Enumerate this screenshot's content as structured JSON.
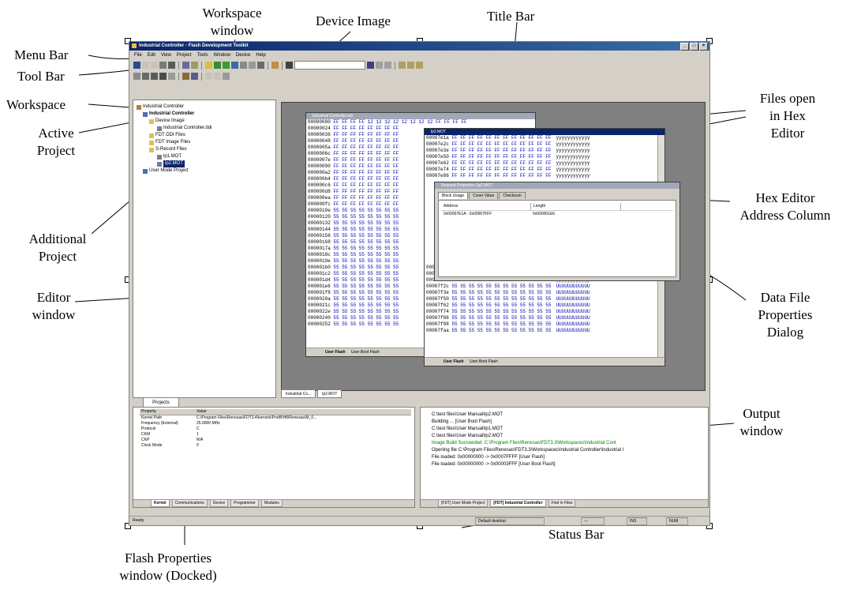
{
  "callouts": {
    "workspace_window": "Workspace window",
    "device_image": "Device Image",
    "title_bar": "Title Bar",
    "menu_bar": "Menu Bar",
    "tool_bar": "Tool Bar",
    "workspace": "Workspace",
    "active_project": "Active Project",
    "files_open_line1": "Files open",
    "files_open_line2": "in Hex",
    "files_open_line3": "Editor",
    "hex_addr_line1": "Hex Editor",
    "hex_addr_line2": "Address Column",
    "additional_project_line1": "Additional",
    "additional_project_line2": "Project",
    "editor_window_line1": "Editor",
    "editor_window_line2": "window",
    "data_file_line1": "Data File",
    "data_file_line2": "Properties",
    "data_file_line3": "Dialog",
    "output_window_line1": "Output",
    "output_window_line2": "window",
    "status_bar": "Status Bar",
    "flash_props_line1": "Flash Properties",
    "flash_props_line2": "window (Docked)"
  },
  "app": {
    "title": "Industrial Controller - Flash Development Toolkit",
    "menu": [
      "File",
      "Edit",
      "View",
      "Project",
      "Tools",
      "Window",
      "Device",
      "Help"
    ],
    "tree": {
      "workspace": "Industrial Controller",
      "active_project": "Industrial Controller",
      "device_image": "Device Image",
      "device_image_file": "Industrial Controller.ddi",
      "fdt_ddi": "FDT DDI Files",
      "fdt_image": "FDT Image Files",
      "srecord": "S-Record Files",
      "file1": "lp1.MOT",
      "file2": "lp2.MOT",
      "additional_project": "User Mode Project"
    },
    "workspace_tab": "Projects",
    "hex1_title": "Industrial Controller.ddi",
    "hex1_rows": [
      [
        "00000000",
        "FF FF FF FF 12 12 12 12 12 12 12 12 FF FF FF FF"
      ],
      [
        "00000024",
        "FF FF FF FF FF FF FF FF"
      ],
      [
        "00000036",
        "FF FF FF FF FF FF FF FF"
      ],
      [
        "00000048",
        "FF FF FF FF FF FF FF FF"
      ],
      [
        "0000005a",
        "FF FF FF FF FF FF FF FF"
      ],
      [
        "0000006c",
        "FF FF FF FF FF FF FF FF"
      ],
      [
        "0000007e",
        "FF FF FF FF FF FF FF FF"
      ],
      [
        "00000090",
        "FF FF FF FF FF FF FF FF"
      ],
      [
        "000000a2",
        "FF FF FF FF FF FF FF FF"
      ],
      [
        "000000b4",
        "FF FF FF FF FF FF FF FF"
      ],
      [
        "000000c6",
        "FF FF FF FF FF FF FF FF"
      ],
      [
        "000000d8",
        "FF FF FF FF FF FF FF FF"
      ],
      [
        "000000ea",
        "FF FF FF FF FF FF FF FF"
      ],
      [
        "000000fc",
        "FF FF FF FF FF FF FF FF"
      ],
      [
        "0000010e",
        "55 55 55 55 55 55 55 55"
      ],
      [
        "00000120",
        "55 55 55 55 55 55 55 55"
      ],
      [
        "00000132",
        "55 55 55 55 55 55 55 55"
      ],
      [
        "00000144",
        "55 55 55 55 55 55 55 55"
      ],
      [
        "00000156",
        "55 55 55 55 55 55 55 55"
      ],
      [
        "00000168",
        "55 55 55 55 55 55 55 55"
      ],
      [
        "0000017a",
        "55 55 55 55 55 55 55 55"
      ],
      [
        "0000018c",
        "55 55 55 55 55 55 55 55"
      ],
      [
        "0000019e",
        "55 55 55 55 55 55 55 55"
      ],
      [
        "000001b0",
        "55 55 55 55 55 55 55 55"
      ],
      [
        "000001c2",
        "55 55 55 55 55 55 55 55"
      ],
      [
        "000001d4",
        "55 55 55 55 55 55 55 55"
      ],
      [
        "000001e6",
        "55 55 55 55 55 55 55 55"
      ],
      [
        "000001f8",
        "55 55 55 55 55 55 55 55"
      ],
      [
        "0000020a",
        "55 55 55 55 55 55 55 55"
      ],
      [
        "0000021c",
        "55 55 55 55 55 55 55 55"
      ],
      [
        "0000022e",
        "55 55 55 55 55 55 55 55"
      ],
      [
        "00000240",
        "55 55 55 55 55 55 55 55"
      ],
      [
        "00000252",
        "55 55 55 55 55 55 55 55"
      ]
    ],
    "hex1_tabs": [
      "User Flash",
      "User Boot Flash"
    ],
    "hex2_title": "lp2.MOT",
    "hex2_rows": [
      [
        "00007e1a",
        "FF FF FF FF FF FF FF FF FF FF FF FF",
        "yyyyyyyyyyyy"
      ],
      [
        "00007e2c",
        "FF FF FF FF FF FF FF FF FF FF FF FF",
        "yyyyyyyyyyyy"
      ],
      [
        "00007e3e",
        "FF FF FF FF FF FF FF FF FF FF FF FF",
        "yyyyyyyyyyyy"
      ],
      [
        "00007e50",
        "FF FF FF FF FF FF FF FF FF FF FF FF",
        "yyyyyyyyyyyy"
      ],
      [
        "00007e62",
        "FF FF FF FF FF FF FF FF FF FF FF FF",
        "yyyyyyyyyyyy"
      ],
      [
        "00007e74",
        "FF FF FF FF FF FF FF FF FF FF FF FF",
        "yyyyyyyyyyyy"
      ],
      [
        "00007e86",
        "FF FF FF FF FF FF FF FF FF FF FF FF",
        "yyyyyyyyyyyy"
      ]
    ],
    "hex2_rows_bottom": [
      [
        "00007ef6",
        "FF FF FF FF FF FF FF FF FF FF FF FF",
        "yyyyyyyyyyyy"
      ],
      [
        "00007f08",
        "FF FF FF FF FF FF FF FF FF FF FF FF",
        "yyyyyyyyyyyy"
      ],
      [
        "00007f1a",
        "FF FF FF FF FF FF FF FF FF FF FF FF",
        "yyyyyyyyyyyy"
      ],
      [
        "00007f2c",
        "55 55 55 55 55 55 55 55 55 55 55 55",
        "UUUUUUUUUUUU"
      ],
      [
        "00007f3e",
        "55 55 55 55 55 55 55 55 55 55 55 55",
        "UUUUUUUUUUUU"
      ],
      [
        "00007f50",
        "55 55 55 55 55 55 55 55 55 55 55 55",
        "UUUUUUUUUUUU"
      ],
      [
        "00007f62",
        "55 55 55 55 55 55 55 55 55 55 55 55",
        "UUUUUUUUUUUU"
      ],
      [
        "00007f74",
        "55 55 55 55 55 55 55 55 55 55 55 55",
        "UUUUUUUUUUUU"
      ],
      [
        "00007f86",
        "55 55 55 55 55 55 55 55 55 55 55 55",
        "UUUUUUUUUUUU"
      ],
      [
        "00007f98",
        "55 55 55 55 55 55 55 55 55 55 55 55",
        "UUUUUUUUUUUU"
      ],
      [
        "00007faa",
        "55 55 55 55 55 55 55 55 55 55 55 55",
        "UUUUUUUUUUUU"
      ]
    ],
    "hex2_tabs": [
      "User Flash",
      "User Boot Flash"
    ],
    "dialog": {
      "title": "Request Properties Sp2.MOT",
      "tabs": [
        "Block Usage",
        "Cover Value",
        "Checksum"
      ],
      "col_address": "Address",
      "col_length": "Length",
      "row_address": "0x00007E1A - 0x00007FFF",
      "row_length": "0x000001E6"
    },
    "doc_tabs": [
      "Industrial Co...",
      "lp2.MOT"
    ],
    "props": {
      "header": [
        "Property",
        "Value"
      ],
      "rows": [
        [
          "Kernel Path",
          "C:\\Program Files\\Renesas\\FDT3.4\\kernels\\ProtB\\H8\\Renesas\\M_0..."
        ],
        [
          "Frequency (External)",
          "25.0000 MHz"
        ],
        [
          "Protocol",
          "C"
        ],
        [
          "CKM",
          "1"
        ],
        [
          "CKP",
          "N/A"
        ],
        [
          "Clock Mode",
          "0"
        ]
      ],
      "tabs": [
        "Kernel",
        "Communications",
        "Device",
        "Programmer",
        "Modules"
      ]
    },
    "output": {
      "lines": [
        "C:\\test files\\User Manual\\lp2.MOT",
        "Building ... [User Boot Flash]",
        "C:\\test files\\User Manual\\lp1.MOT",
        "C:\\test files\\User Manual\\lp2.MOT",
        "Image Build Succeeded: C:\\Program Files\\Renesas\\FDT3.3\\Workspaces\\Industrial Cont",
        "Opening file C:\\Program Files\\Renesas\\FDT3.3\\Workspaces\\Industrial Controller\\Industrial I",
        "  File loaded: 0x00000000 -> 0x0007FFFF  [User Flash]",
        "  File loaded: 0x00000000 -> 0x00003FFF  [User Boot Flash]"
      ],
      "tabs": [
        "[FDT] User Mode Project",
        "[FDT] Industrial Controller",
        "Find in Files"
      ]
    },
    "status": {
      "left": "Ready",
      "mid": "Default desktop",
      "right1": "---",
      "right2": "INS",
      "right3": "NUM"
    }
  },
  "colors": {
    "titlebar_start": "#0a246a",
    "titlebar_end": "#3a6ea5",
    "window_face": "#d4d0c8",
    "editor_bg": "#808080",
    "output_success": "#008000",
    "hex_data": "#0000aa"
  }
}
